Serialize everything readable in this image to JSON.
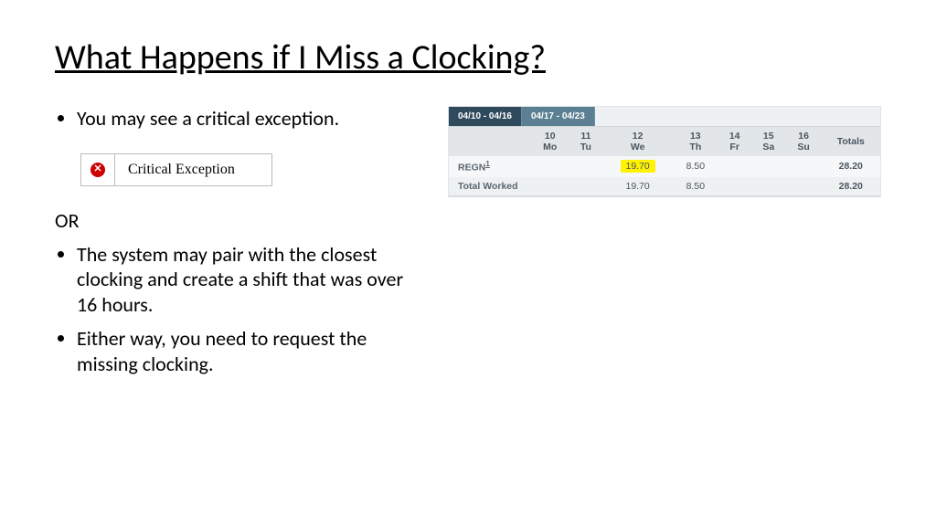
{
  "title": "What Happens if I Miss a Clocking?",
  "bullets_top": [
    "You may see a critical exception."
  ],
  "crit_exception_label": "Critical Exception",
  "or_label": "OR",
  "bullets_bottom": [
    "The system may pair with the closest clocking and create a shift that was over 16 hours.",
    "Either way, you need to request the missing clocking."
  ],
  "timecard": {
    "tabs": [
      {
        "label": "04/10 - 04/16",
        "active": true
      },
      {
        "label": "04/17 - 04/23",
        "active": false
      }
    ],
    "days": [
      {
        "num": "10",
        "dow": "Mo"
      },
      {
        "num": "11",
        "dow": "Tu"
      },
      {
        "num": "12",
        "dow": "We"
      },
      {
        "num": "13",
        "dow": "Th"
      },
      {
        "num": "14",
        "dow": "Fr"
      },
      {
        "num": "15",
        "dow": "Sa"
      },
      {
        "num": "16",
        "dow": "Su"
      }
    ],
    "totals_header": "Totals",
    "rows": [
      {
        "label": "REGN",
        "sup": "1",
        "cells": [
          "",
          "",
          "19.70",
          "8.50",
          "",
          "",
          ""
        ],
        "total": "28.20",
        "highlight_index": 2
      },
      {
        "label": "Total Worked",
        "sup": "",
        "cells": [
          "",
          "",
          "19.70",
          "8.50",
          "",
          "",
          ""
        ],
        "total": "28.20",
        "highlight_index": -1
      }
    ]
  }
}
